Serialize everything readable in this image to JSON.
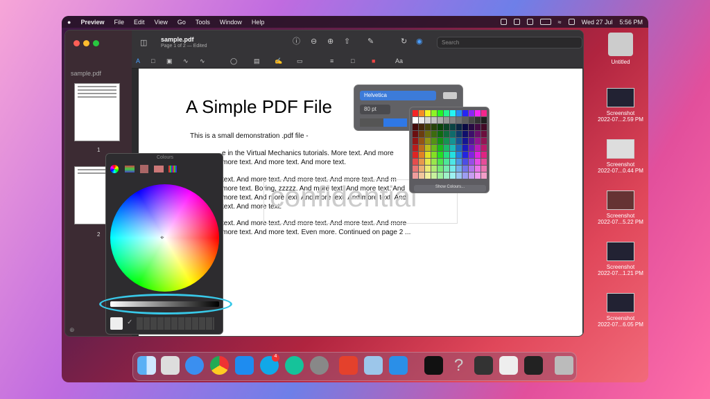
{
  "menubar": {
    "apple": "",
    "app": "Preview",
    "items": [
      "File",
      "Edit",
      "View",
      "Go",
      "Tools",
      "Window",
      "Help"
    ],
    "date": "Wed 27 Jul",
    "time": "5:56 PM"
  },
  "window": {
    "title": "sample.pdf",
    "subtitle": "Page 1 of 2 — Edited",
    "search_placeholder": "Search"
  },
  "sidebar": {
    "title": "sample.pdf",
    "pages": [
      "1",
      "2"
    ]
  },
  "pdf": {
    "title": "A Simple PDF File",
    "lines": [
      "This is a small demonstration .pdf file -",
      "e in the Virtual Mechanics tutorials. More text. And more",
      "more text. And more text. And more text.",
      "text. And more text. And more text. And more text. And m",
      "more text. Boring, zzzzz. And more text. And more text. And",
      "more text. And more text. And more text. And more text. And",
      "text. And more text.",
      "text. And more text. And more text. And more text. And more",
      "more text. And more text. Even more. Continued on page 2 ..."
    ],
    "watermark": "confidential"
  },
  "font_panel": {
    "font": "Helvetica",
    "size": "80 pt"
  },
  "color_grid": {
    "show_colours": "Show Colours..."
  },
  "colours_panel": {
    "title": "Colours"
  },
  "desktop": [
    {
      "label": "Untitled"
    },
    {
      "label": "Screenshot",
      "sub": "2022-07...2.59 PM"
    },
    {
      "label": "Screenshot",
      "sub": "2022-07...0.44 PM"
    },
    {
      "label": "Screenshot",
      "sub": "2022-07...5.22 PM"
    },
    {
      "label": "Screenshot",
      "sub": "2022-07...1.21 PM"
    },
    {
      "label": "Screenshot",
      "sub": "2022-07...6.05 PM"
    }
  ],
  "dock": {
    "badge": "4"
  }
}
